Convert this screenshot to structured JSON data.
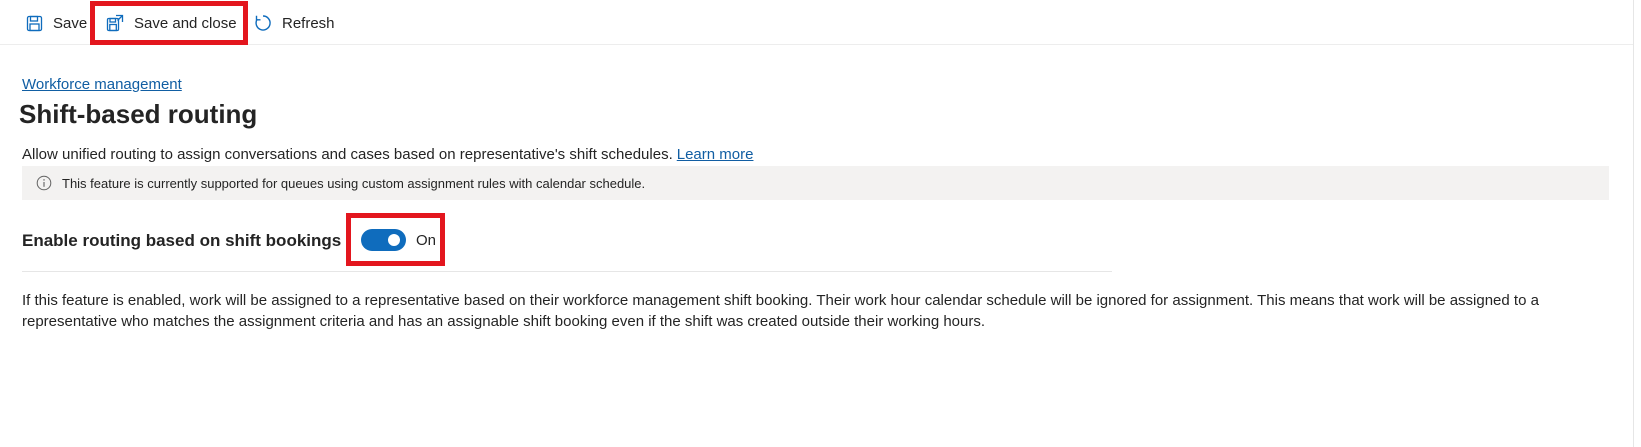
{
  "toolbar": {
    "save_label": "Save",
    "save_close_label": "Save and close",
    "refresh_label": "Refresh"
  },
  "breadcrumb": "Workforce management",
  "page_title": "Shift-based routing",
  "description": {
    "text": "Allow unified routing to assign conversations and cases based on representative's shift schedules.",
    "link": "Learn more"
  },
  "info_bar": {
    "icon": "info-icon",
    "text": "This feature is currently supported for queues using custom assignment rules with calendar schedule."
  },
  "setting": {
    "label": "Enable routing based on shift bookings",
    "toggle_state": "On",
    "toggle_on": true
  },
  "explanation": "If this feature is enabled, work will be assigned to a representative based on their workforce management shift booking. Their work hour calendar schedule will be ignored for assignment. This means that work will be assigned to a representative who matches the assignment criteria and has an assignable shift booking even if the shift was created outside their working hours.",
  "colors": {
    "accent": "#0f6cbd",
    "link": "#115ea3",
    "highlight": "#e3161e",
    "info_bg": "#f3f2f1"
  }
}
